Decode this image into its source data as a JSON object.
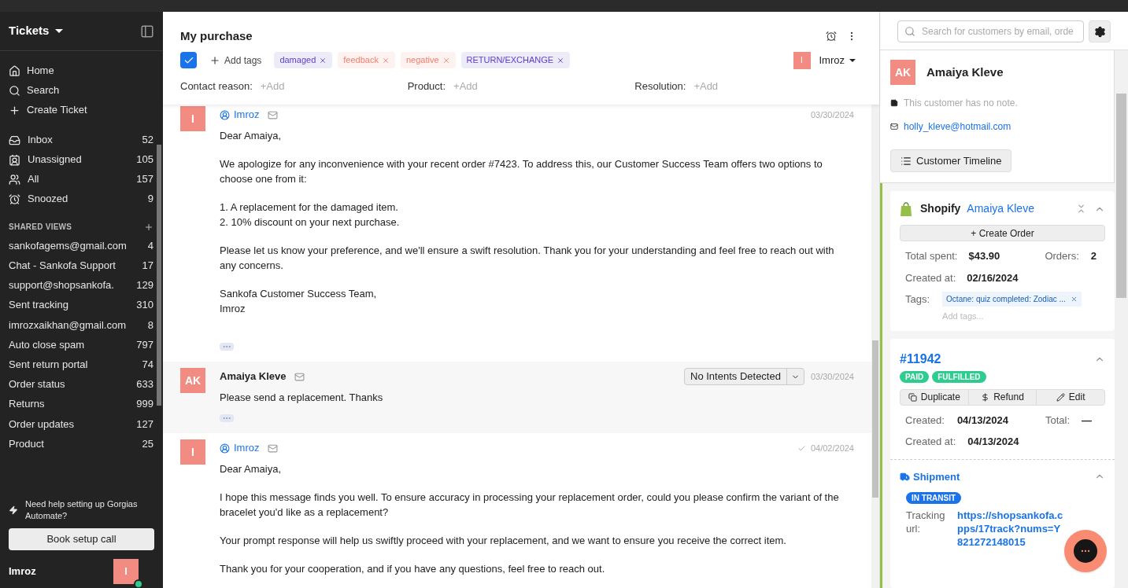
{
  "sidebar": {
    "title": "Tickets",
    "nav": [
      {
        "label": "Home"
      },
      {
        "label": "Search"
      },
      {
        "label": "Create Ticket"
      }
    ],
    "views": [
      {
        "label": "Inbox",
        "count": "52"
      },
      {
        "label": "Unassigned",
        "count": "105"
      },
      {
        "label": "All",
        "count": "157"
      },
      {
        "label": "Snoozed",
        "count": "9"
      }
    ],
    "shared_title": "SHARED VIEWS",
    "shared_views": [
      {
        "label": "sankofagems@gmail.com",
        "count": "4"
      },
      {
        "label": "Chat - Sankofa Support",
        "count": "17"
      },
      {
        "label": "support@shopsankofa.",
        "count": "129"
      },
      {
        "label": "Sent tracking",
        "count": "310"
      },
      {
        "label": "imrozxaikhan@gmail.com",
        "count": "8"
      },
      {
        "label": "Auto close spam",
        "count": "797"
      },
      {
        "label": "Sent return portal",
        "count": "74"
      },
      {
        "label": "Order status",
        "count": "633"
      },
      {
        "label": "Returns",
        "count": "999"
      },
      {
        "label": "Order updates",
        "count": "127"
      },
      {
        "label": "Product",
        "count": "25"
      }
    ],
    "help_text": "Need help setting up Gorgias Automate?",
    "book_button": "Book setup call",
    "user": {
      "name": "Imroz",
      "initial": "I",
      "online": true
    }
  },
  "ticket": {
    "title": "My purchase",
    "checked": true,
    "add_tags": "Add tags",
    "tags": [
      {
        "label": "damaged",
        "color": "#5b3fc4"
      },
      {
        "label": "feedback",
        "color": "#f07e6e"
      },
      {
        "label": "negative",
        "color": "#f07e6e"
      },
      {
        "label": "RETURN/EXCHANGE",
        "color": "#5b3fc4"
      }
    ],
    "assignee": {
      "initial": "I",
      "name": "Imroz"
    },
    "fields": [
      {
        "label": "Contact reason:",
        "placeholder": "+Add"
      },
      {
        "label": "Product:",
        "placeholder": "+Add"
      },
      {
        "label": "Resolution:",
        "placeholder": "+Add"
      }
    ]
  },
  "messages": [
    {
      "author": "Imroz",
      "initial": "I",
      "agent": true,
      "date": "03/30/2024",
      "delivered": false,
      "body": [
        "Dear Amaiya,",
        "We apologize for any inconvenience with your recent order #7423. To address this, our Customer Success Team offers two options to choose one from it:",
        "1. A replacement for the damaged item.\n2. 10% discount on your next purchase.",
        "Please let us know your preference, and we'll ensure a swift resolution. Thank you for your understanding and feel free to reach out with any concerns.",
        "Sankofa Customer Success Team,\nImroz"
      ]
    },
    {
      "author": "Amaiya Kleve",
      "initial": "AK",
      "agent": false,
      "date": "03/30/2024",
      "delivered": false,
      "intent": "No Intents Detected",
      "body": [
        "Please send a replacement. Thanks"
      ]
    },
    {
      "author": "Imroz",
      "initial": "I",
      "agent": true,
      "date": "04/02/2024",
      "delivered": true,
      "body": [
        "Dear Amaiya,",
        "I hope this message finds you well. To ensure accuracy in processing your replacement order, could you please confirm the variant of the bracelet you'd like as a replacement?",
        "Your prompt response will help us swiftly proceed with your replacement, and we want to ensure you receive the correct item.",
        "Thank you for your cooperation, and if you have any questions, feel free to reach out."
      ]
    }
  ],
  "customer_panel": {
    "search_placeholder": "Search for customers by email, orde",
    "customer": {
      "initials": "AK",
      "name": "Amaiya Kleve",
      "note": "This customer has no note.",
      "email": "holly_kleve@hotmail.com",
      "timeline_button": "Customer Timeline"
    },
    "shopify": {
      "title": "Shopify",
      "name": "Amaiya Kleve",
      "create_order": "+ Create Order",
      "total_label": "Total spent:",
      "total": "$43.90",
      "orders_label": "Orders:",
      "orders": "2",
      "created_label": "Created at:",
      "created": "02/16/2024",
      "tags_label": "Tags:",
      "tag": "Octane: quiz completed: Zodiac ...",
      "add_tags": "Add tags..."
    },
    "order": {
      "number": "#11942",
      "badges": [
        "PAID",
        "FULFILLED"
      ],
      "actions": [
        {
          "label": "Duplicate"
        },
        {
          "label": "Refund"
        },
        {
          "label": "Edit"
        }
      ],
      "created_label": "Created:",
      "created": "04/13/2024",
      "total_label": "Total:",
      "total": "—",
      "created_at_label": "Created at:",
      "created_at": "04/13/2024"
    },
    "shipment": {
      "title": "Shipment",
      "status": "IN TRANSIT",
      "label_lines": [
        "Tracking",
        "url:"
      ],
      "url_lines": [
        "https://shopsankofa.c",
        "pps/17track?nums=Y",
        "821272148015"
      ]
    }
  }
}
